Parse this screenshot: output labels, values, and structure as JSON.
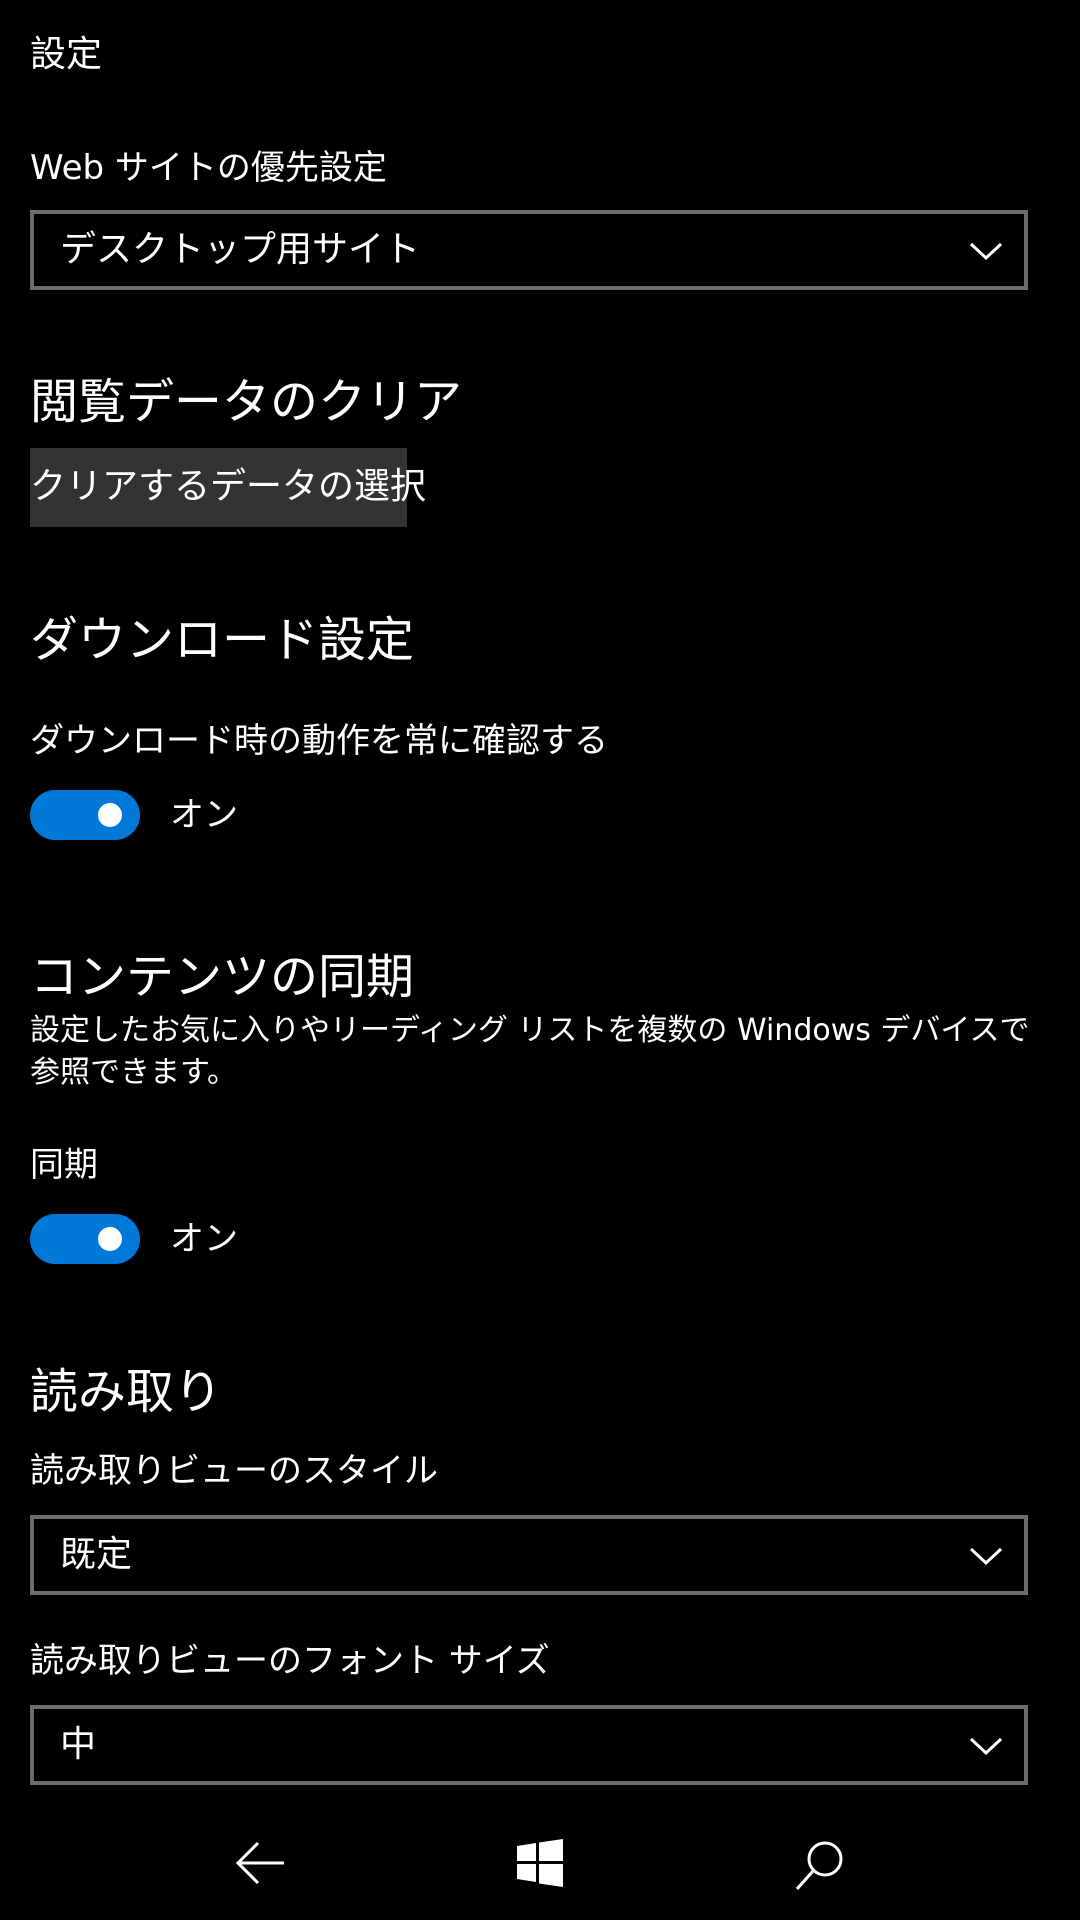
{
  "page": {
    "title": "設定"
  },
  "website_preference": {
    "label": "Web サイトの優先設定",
    "selected": "デスクトップ用サイト"
  },
  "clear_browsing": {
    "heading": "閲覧データのクリア",
    "button_label": "クリアするデータの選択"
  },
  "downloads": {
    "heading": "ダウンロード設定",
    "ask_label": "ダウンロード時の動作を常に確認する",
    "ask_toggle_text": "オン",
    "ask_toggle_on": true
  },
  "sync": {
    "heading": "コンテンツの同期",
    "description": "設定したお気に入りやリーディング リストを複数の Windows デバイスで参照できます。",
    "label": "同期",
    "toggle_text": "オン",
    "toggle_on": true
  },
  "reading": {
    "heading": "読み取り",
    "style_label": "読み取りビューのスタイル",
    "style_selected": "既定",
    "font_size_label": "読み取りビューのフォント サイズ",
    "font_size_selected": "中"
  },
  "navbar": {
    "icons": [
      "back-arrow-icon",
      "windows-logo-icon",
      "search-icon"
    ]
  },
  "colors": {
    "background": "#000000",
    "accent": "#0078d7",
    "combo_border": "#6d6d6d",
    "button_bg": "#333333"
  }
}
